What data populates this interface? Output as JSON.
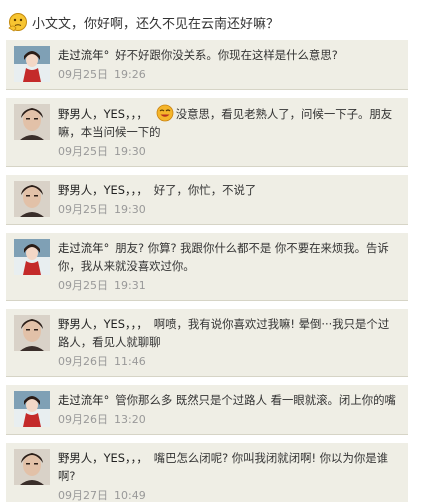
{
  "header": {
    "icon": "thinking-emoji-icon",
    "text": "小文文，你好啊，还久不见在云南还好嘛？"
  },
  "messages": [
    {
      "author": "走过流年°",
      "text": "好不好跟你没关系。你现在这样是什么意思?",
      "date": "09月25日",
      "time": "19:26",
      "avatar": "avatar-girl-red-scarf"
    },
    {
      "author": "野男人，YES，，，",
      "text_before": "",
      "text_after": "没意思，看见老熟人了，问候一下子。朋友嘛，本当问候一下的",
      "emoji": "laughing-emoji-icon",
      "date": "09月25日",
      "time": "19:30",
      "avatar": "avatar-man-portrait"
    },
    {
      "author": "野男人，YES，，，",
      "text": "好了，你忙，不说了",
      "date": "09月25日",
      "time": "19:30",
      "avatar": "avatar-man-portrait"
    },
    {
      "author": "走过流年°",
      "text": "朋友? 你算? 我跟你什么都不是 你不要在来烦我。告诉你，我从来就没喜欢过你。",
      "date": "09月25日",
      "time": "19:31",
      "avatar": "avatar-girl-red-scarf"
    },
    {
      "author": "野男人，YES，，，",
      "text": "啊喷，我有说你喜欢过我嘛! 晕倒···我只是个过路人，看见人就聊聊",
      "date": "09月26日",
      "time": "11:46",
      "avatar": "avatar-man-portrait"
    },
    {
      "author": "走过流年°",
      "text": "管你那么多 既然只是个过路人 看一眼就滚。闭上你的嘴",
      "date": "09月26日",
      "time": "13:20",
      "avatar": "avatar-girl-red-scarf"
    },
    {
      "author": "野男人，YES，，，",
      "text": "嘴巴怎么闭呢? 你叫我闭就闭啊! 你以为你是谁啊?",
      "date": "09月27日",
      "time": "10:49",
      "avatar": "avatar-man-portrait"
    }
  ]
}
